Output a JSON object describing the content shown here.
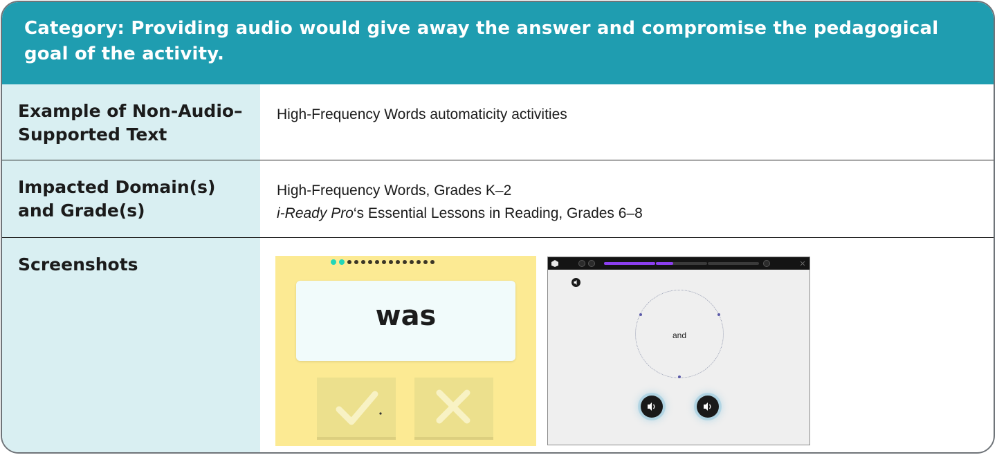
{
  "header": {
    "title": "Category: Providing audio would give away the answer and compromise the pedagogical goal of the activity."
  },
  "rows": [
    {
      "label": "Example of Non-Audio–Supported Text",
      "value_lines": [
        "High-Frequency Words automaticity activities"
      ]
    },
    {
      "label": "Impacted Domain(s) and Grade(s)",
      "value_lines": [
        "High-Frequency Words, Grades K–2"
      ],
      "value_italic_prefix": "i-Ready Pro",
      "value_suffix": "‘s Essential Lessons in Reading, Grades 6–8"
    },
    {
      "label": "Screenshots"
    }
  ],
  "screenshots": {
    "first": {
      "word": "was",
      "progress_dots_total": 15,
      "progress_dots_active": 2,
      "buttons": [
        "check-icon",
        "x-icon"
      ]
    },
    "second": {
      "word": "and",
      "progress_segments_filled": 1.5,
      "progress_segments_total": 4,
      "icons": [
        "app-logo-icon",
        "info-icon",
        "settings-icon",
        "pause-icon",
        "close-icon",
        "speaker-icon"
      ]
    }
  },
  "colors": {
    "header_bg": "#1f9db0",
    "label_bg": "#d9eff2",
    "shot1_bg": "#fcea93",
    "progress_fill": "#8c3ff0",
    "active_dot": "#22d6b8"
  }
}
